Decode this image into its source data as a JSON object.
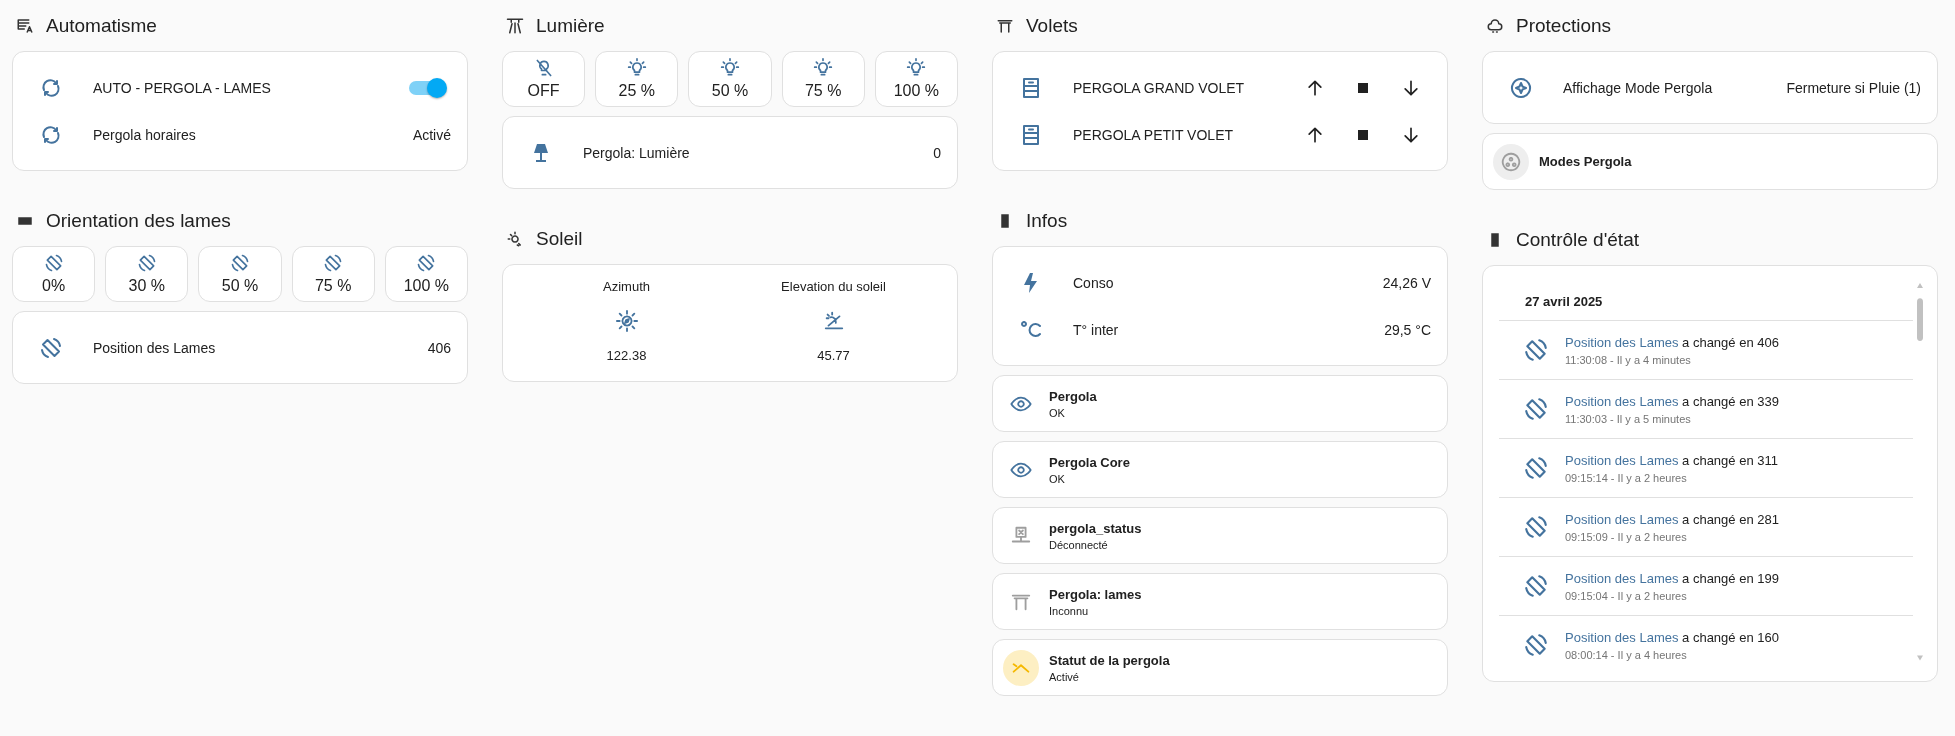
{
  "automatisme": {
    "title": "Automatisme",
    "rows": [
      {
        "kind": "toggle",
        "name": "AUTO - PERGOLA - LAMES",
        "on": true
      },
      {
        "kind": "state",
        "name": "Pergola horaires",
        "state": "Activé"
      }
    ]
  },
  "orientation": {
    "title": "Orientation des lames",
    "buttons": [
      "0%",
      "30 %",
      "50 %",
      "75 %",
      "100 %"
    ],
    "entity": {
      "name": "Position des Lames",
      "state": "406"
    }
  },
  "lumiere": {
    "title": "Lumière",
    "buttons": [
      "OFF",
      "25 %",
      "50 %",
      "75 %",
      "100 %"
    ],
    "entity": {
      "name": "Pergola: Lumière",
      "state": "0"
    }
  },
  "soleil": {
    "title": "Soleil",
    "items": [
      {
        "name": "Azimuth",
        "state": "122.38"
      },
      {
        "name": "Elevation du soleil",
        "state": "45.77"
      }
    ]
  },
  "volets": {
    "title": "Volets",
    "rows": [
      {
        "name": "PERGOLA GRAND VOLET"
      },
      {
        "name": "PERGOLA PETIT VOLET"
      }
    ]
  },
  "infos": {
    "title": "Infos",
    "rows": [
      {
        "name": "Conso",
        "state": "24,26 V"
      },
      {
        "name": "T° inter",
        "state": "29,5 °C"
      }
    ],
    "tiles": [
      {
        "kind": "ok",
        "name": "Pergola",
        "state": "OK"
      },
      {
        "kind": "ok",
        "name": "Pergola Core",
        "state": "OK"
      },
      {
        "kind": "unavailable",
        "name": "pergola_status",
        "state": "Déconnecté"
      },
      {
        "kind": "unavailable",
        "name": "Pergola: lames",
        "state": "Inconnu"
      },
      {
        "kind": "active",
        "name": "Statut de la pergola",
        "state": "Activé"
      }
    ]
  },
  "protections": {
    "title": "Protections",
    "row": {
      "name": "Affichage Mode Pergola",
      "state": "Fermeture si Pluie (1)"
    },
    "tile": {
      "kind": "idle",
      "name": "Modes Pergola"
    }
  },
  "controle": {
    "title": "Contrôle d'état",
    "date": "27 avril 2025",
    "entries": [
      {
        "entity": "Position des Lames",
        "message": "a changé en 406",
        "time": "11:30:08 - Il y a 4 minutes"
      },
      {
        "entity": "Position des Lames",
        "message": "a changé en 339",
        "time": "11:30:03 - Il y a 5 minutes"
      },
      {
        "entity": "Position des Lames",
        "message": "a changé en 311",
        "time": "09:15:14 - Il y a 2 heures"
      },
      {
        "entity": "Position des Lames",
        "message": "a changé en 281",
        "time": "09:15:09 - Il y a 2 heures"
      },
      {
        "entity": "Position des Lames",
        "message": "a changé en 199",
        "time": "09:15:04 - Il y a 2 heures"
      },
      {
        "entity": "Position des Lames",
        "message": "a changé en 160",
        "time": "08:00:14 - Il y a 4 heures"
      }
    ]
  }
}
